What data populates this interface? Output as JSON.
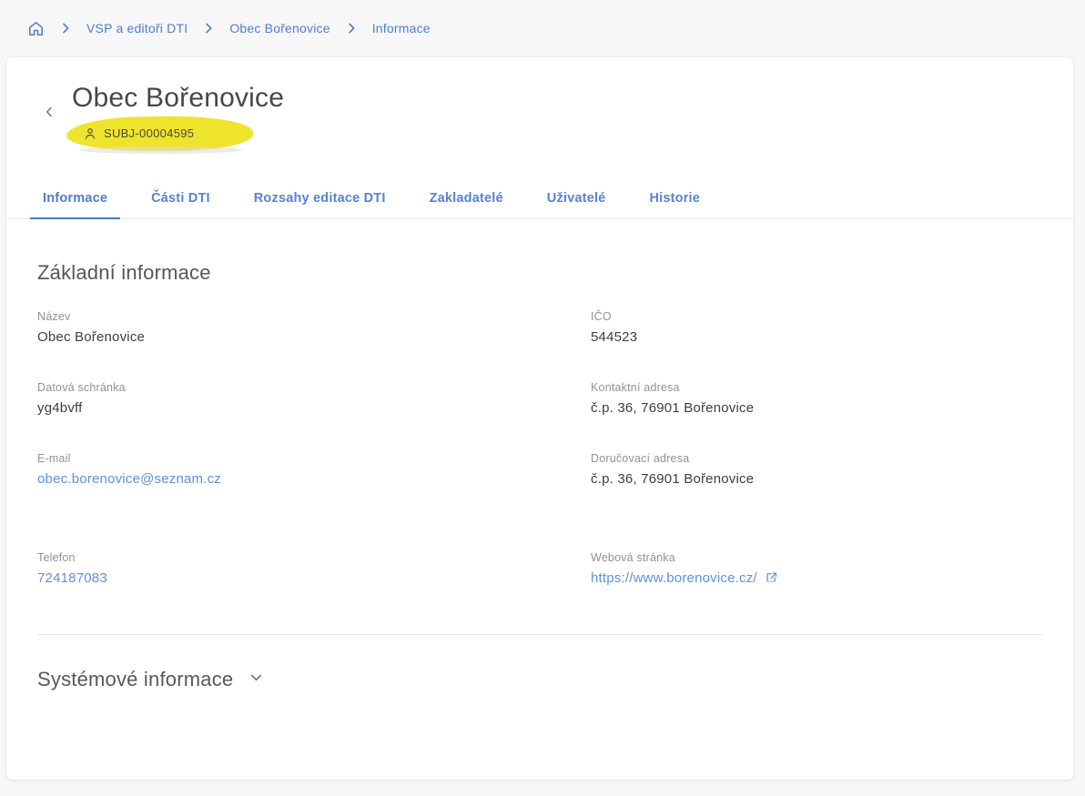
{
  "breadcrumb": {
    "items": [
      "VSP a editoři DTI",
      "Obec Bořenovice",
      "Informace"
    ]
  },
  "header": {
    "title": "Obec Bořenovice",
    "subject_id": "SUBJ-00004595"
  },
  "tabs": [
    {
      "label": "Informace",
      "active": true
    },
    {
      "label": "Části DTI",
      "active": false
    },
    {
      "label": "Rozsahy editace DTI",
      "active": false
    },
    {
      "label": "Zakladatelé",
      "active": false
    },
    {
      "label": "Uživatelé",
      "active": false
    },
    {
      "label": "Historie",
      "active": false
    }
  ],
  "basic_section": {
    "title": "Základní informace",
    "fields": [
      {
        "label": "Název",
        "value": "Obec Bořenovice",
        "type": "text"
      },
      {
        "label": "IČO",
        "value": "544523",
        "type": "text"
      },
      {
        "label": "Datová schránka",
        "value": "yg4bvff",
        "type": "text"
      },
      {
        "label": "Kontaktní adresa",
        "value": "č.p. 36, 76901 Bořenovice",
        "type": "text"
      },
      {
        "label": "E-mail",
        "value": "obec.borenovice@seznam.cz",
        "type": "link"
      },
      {
        "label": "Doručovací adresa",
        "value": "č.p. 36, 76901 Bořenovice",
        "type": "text"
      },
      {
        "label": "Telefon",
        "value": "724187083",
        "type": "link"
      },
      {
        "label": "Webová stránka",
        "value": "https://www.borenovice.cz/",
        "type": "link-external"
      }
    ]
  },
  "system_section": {
    "title": "Systémové informace"
  },
  "icons": {
    "breadcrumb_home": "home-icon",
    "breadcrumb_separator": "chevron-right-icon",
    "back": "chevron-left-icon",
    "subject_chip": "person-icon",
    "web_link": "external-link-icon",
    "system_collapse": "chevron-down-icon"
  },
  "colors": {
    "accent_blue": "#4d7cd3",
    "link_blue": "#5e90e2",
    "highlight_yellow": "#efe42c",
    "page_background": "#f7f7f7",
    "card_background": "#ffffff"
  }
}
